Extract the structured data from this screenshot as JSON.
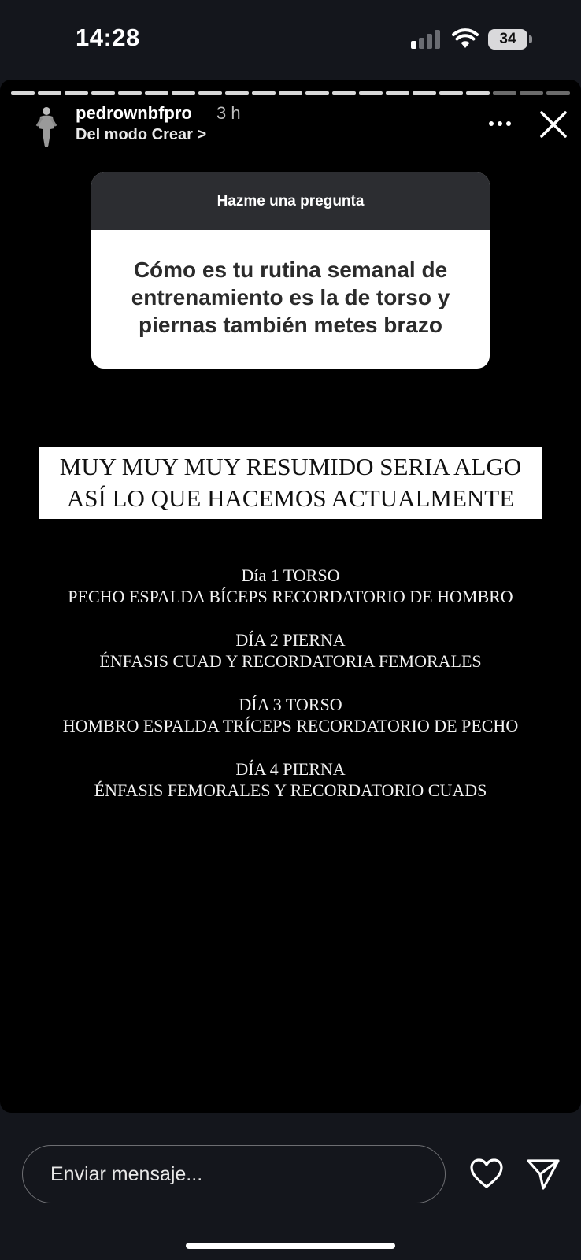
{
  "status_bar": {
    "time": "14:28",
    "battery": "34",
    "signal_bars_active": 1
  },
  "story": {
    "progress_segments_total": 21,
    "progress_segments_viewed": 18,
    "username": "pedrownbfpro",
    "time_ago": "3 h",
    "subline": "Del modo Crear >",
    "question": {
      "title": "Hazme una pregunta",
      "text": "Cómo es tu rutina semanal de entrenamiento es la de torso y piernas  también metes brazo"
    },
    "headline": {
      "line1": "MUY MUY MUY RESUMIDO SERIA ALGO",
      "line2": "ASÍ LO QUE HACEMOS ACTUALMENTE"
    },
    "days": [
      {
        "title": "Día 1 TORSO",
        "detail": "PECHO ESPALDA BÍCEPS RECORDATORIO DE HOMBRO"
      },
      {
        "title": "DÍA 2 PIERNA",
        "detail": "ÉNFASIS CUAD Y RECORDATORIA FEMORALES"
      },
      {
        "title": "DÍA 3 TORSO",
        "detail": "HOMBRO ESPALDA TRÍCEPS RECORDATORIO DE PECHO"
      },
      {
        "title": "DÍA 4 PIERNA",
        "detail": "ÉNFASIS FEMORALES Y RECORDATORIO CUADS"
      }
    ]
  },
  "composer": {
    "placeholder": "Enviar mensaje..."
  },
  "icons": {
    "more": "more-horizontal-icon",
    "close": "close-icon",
    "like": "heart-icon",
    "share": "send-icon"
  }
}
